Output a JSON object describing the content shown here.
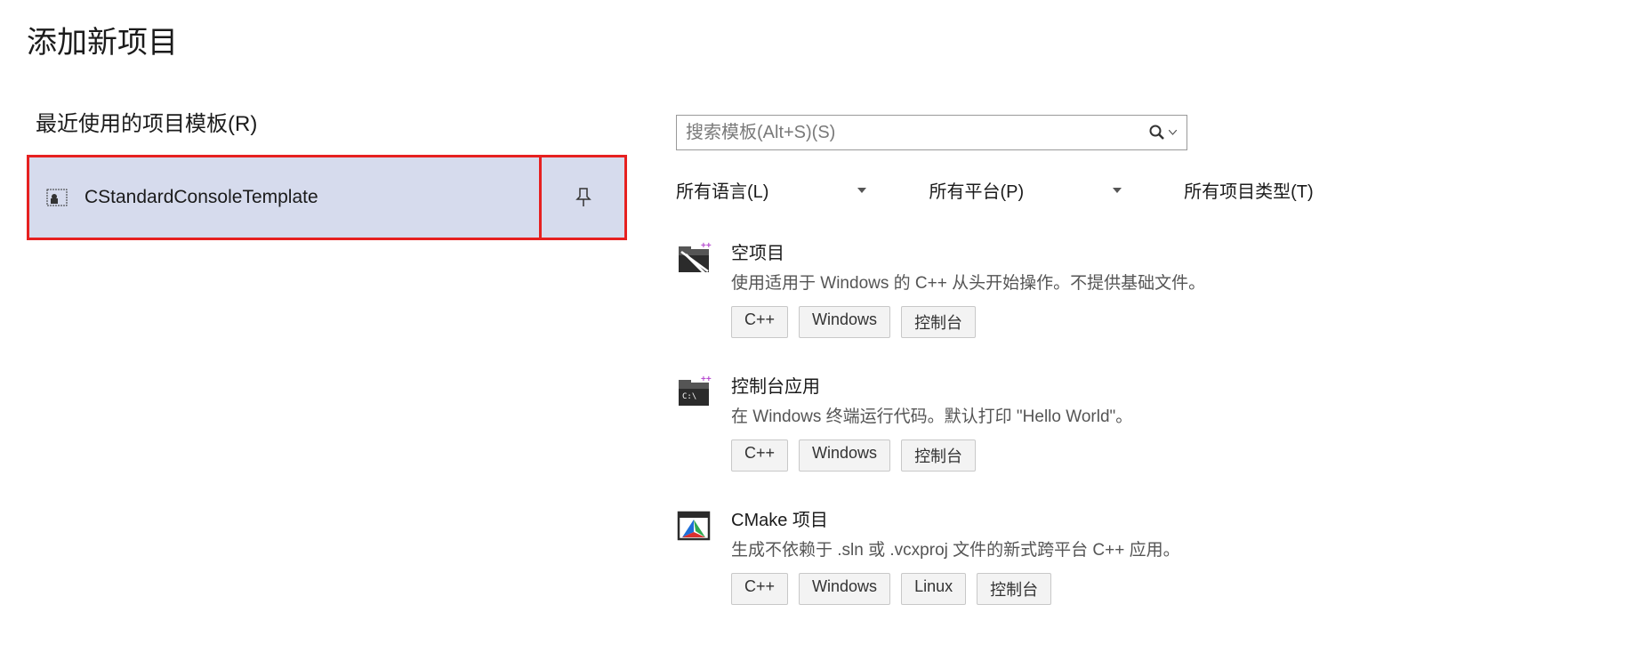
{
  "pageTitle": "添加新项目",
  "recentLabel": "最近使用的项目模板(R)",
  "recentItem": {
    "name": "CStandardConsoleTemplate"
  },
  "search": {
    "placeholder": "搜索模板(Alt+S)(S)"
  },
  "filters": {
    "language": "所有语言(L)",
    "platform": "所有平台(P)",
    "projectType": "所有项目类型(T)"
  },
  "templates": [
    {
      "title": "空项目",
      "desc": "使用适用于 Windows 的 C++ 从头开始操作。不提供基础文件。",
      "tags": [
        "C++",
        "Windows",
        "控制台"
      ]
    },
    {
      "title": "控制台应用",
      "desc": "在 Windows 终端运行代码。默认打印 \"Hello World\"。",
      "tags": [
        "C++",
        "Windows",
        "控制台"
      ]
    },
    {
      "title": "CMake 项目",
      "desc": "生成不依赖于 .sln 或 .vcxproj 文件的新式跨平台 C++ 应用。",
      "tags": [
        "C++",
        "Windows",
        "Linux",
        "控制台"
      ]
    }
  ]
}
